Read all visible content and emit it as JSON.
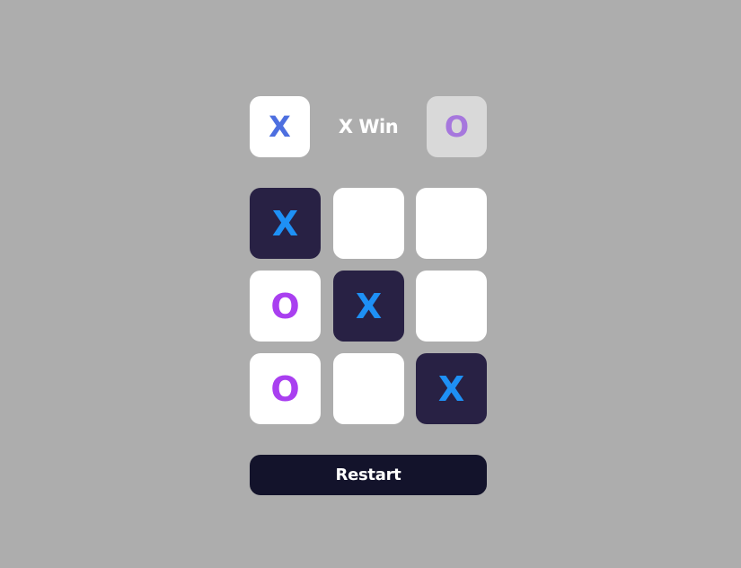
{
  "players": {
    "x_label": "X",
    "o_label": "O"
  },
  "status": "X Win",
  "board": [
    {
      "value": "X",
      "winning": true
    },
    {
      "value": "",
      "winning": false
    },
    {
      "value": "",
      "winning": false
    },
    {
      "value": "O",
      "winning": false
    },
    {
      "value": "X",
      "winning": true
    },
    {
      "value": "",
      "winning": false
    },
    {
      "value": "O",
      "winning": false
    },
    {
      "value": "",
      "winning": false
    },
    {
      "value": "X",
      "winning": true
    }
  ],
  "restart_label": "Restart",
  "colors": {
    "background": "#adadad",
    "cell": "#ffffff",
    "winning_cell": "#282144",
    "x_mark": "#1e90f5",
    "o_mark": "#a93ff0",
    "player_x": "#4d6fe0",
    "player_o": "#a677dd",
    "restart_button": "#13132b"
  }
}
